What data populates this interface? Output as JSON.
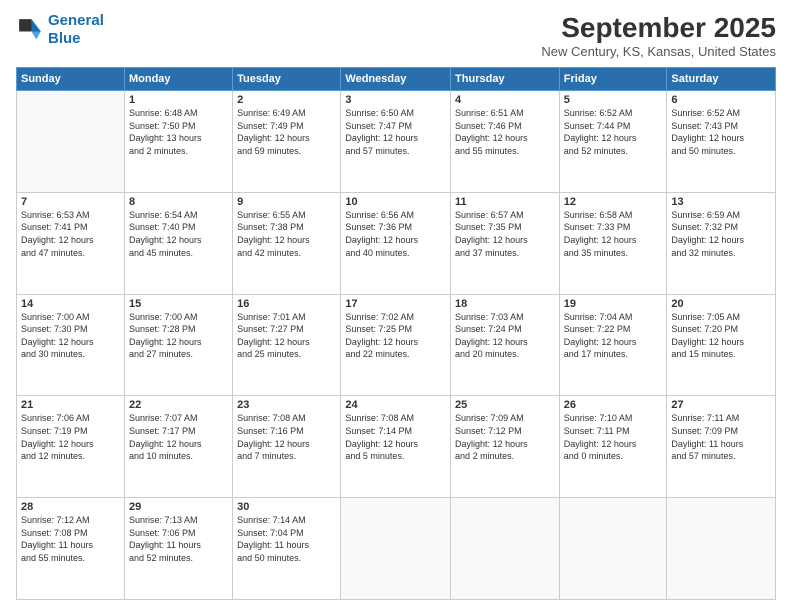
{
  "header": {
    "logo_line1": "General",
    "logo_line2": "Blue",
    "month": "September 2025",
    "location": "New Century, KS, Kansas, United States"
  },
  "weekdays": [
    "Sunday",
    "Monday",
    "Tuesday",
    "Wednesday",
    "Thursday",
    "Friday",
    "Saturday"
  ],
  "weeks": [
    [
      {
        "day": "",
        "info": ""
      },
      {
        "day": "1",
        "info": "Sunrise: 6:48 AM\nSunset: 7:50 PM\nDaylight: 13 hours\nand 2 minutes."
      },
      {
        "day": "2",
        "info": "Sunrise: 6:49 AM\nSunset: 7:49 PM\nDaylight: 12 hours\nand 59 minutes."
      },
      {
        "day": "3",
        "info": "Sunrise: 6:50 AM\nSunset: 7:47 PM\nDaylight: 12 hours\nand 57 minutes."
      },
      {
        "day": "4",
        "info": "Sunrise: 6:51 AM\nSunset: 7:46 PM\nDaylight: 12 hours\nand 55 minutes."
      },
      {
        "day": "5",
        "info": "Sunrise: 6:52 AM\nSunset: 7:44 PM\nDaylight: 12 hours\nand 52 minutes."
      },
      {
        "day": "6",
        "info": "Sunrise: 6:52 AM\nSunset: 7:43 PM\nDaylight: 12 hours\nand 50 minutes."
      }
    ],
    [
      {
        "day": "7",
        "info": "Sunrise: 6:53 AM\nSunset: 7:41 PM\nDaylight: 12 hours\nand 47 minutes."
      },
      {
        "day": "8",
        "info": "Sunrise: 6:54 AM\nSunset: 7:40 PM\nDaylight: 12 hours\nand 45 minutes."
      },
      {
        "day": "9",
        "info": "Sunrise: 6:55 AM\nSunset: 7:38 PM\nDaylight: 12 hours\nand 42 minutes."
      },
      {
        "day": "10",
        "info": "Sunrise: 6:56 AM\nSunset: 7:36 PM\nDaylight: 12 hours\nand 40 minutes."
      },
      {
        "day": "11",
        "info": "Sunrise: 6:57 AM\nSunset: 7:35 PM\nDaylight: 12 hours\nand 37 minutes."
      },
      {
        "day": "12",
        "info": "Sunrise: 6:58 AM\nSunset: 7:33 PM\nDaylight: 12 hours\nand 35 minutes."
      },
      {
        "day": "13",
        "info": "Sunrise: 6:59 AM\nSunset: 7:32 PM\nDaylight: 12 hours\nand 32 minutes."
      }
    ],
    [
      {
        "day": "14",
        "info": "Sunrise: 7:00 AM\nSunset: 7:30 PM\nDaylight: 12 hours\nand 30 minutes."
      },
      {
        "day": "15",
        "info": "Sunrise: 7:00 AM\nSunset: 7:28 PM\nDaylight: 12 hours\nand 27 minutes."
      },
      {
        "day": "16",
        "info": "Sunrise: 7:01 AM\nSunset: 7:27 PM\nDaylight: 12 hours\nand 25 minutes."
      },
      {
        "day": "17",
        "info": "Sunrise: 7:02 AM\nSunset: 7:25 PM\nDaylight: 12 hours\nand 22 minutes."
      },
      {
        "day": "18",
        "info": "Sunrise: 7:03 AM\nSunset: 7:24 PM\nDaylight: 12 hours\nand 20 minutes."
      },
      {
        "day": "19",
        "info": "Sunrise: 7:04 AM\nSunset: 7:22 PM\nDaylight: 12 hours\nand 17 minutes."
      },
      {
        "day": "20",
        "info": "Sunrise: 7:05 AM\nSunset: 7:20 PM\nDaylight: 12 hours\nand 15 minutes."
      }
    ],
    [
      {
        "day": "21",
        "info": "Sunrise: 7:06 AM\nSunset: 7:19 PM\nDaylight: 12 hours\nand 12 minutes."
      },
      {
        "day": "22",
        "info": "Sunrise: 7:07 AM\nSunset: 7:17 PM\nDaylight: 12 hours\nand 10 minutes."
      },
      {
        "day": "23",
        "info": "Sunrise: 7:08 AM\nSunset: 7:16 PM\nDaylight: 12 hours\nand 7 minutes."
      },
      {
        "day": "24",
        "info": "Sunrise: 7:08 AM\nSunset: 7:14 PM\nDaylight: 12 hours\nand 5 minutes."
      },
      {
        "day": "25",
        "info": "Sunrise: 7:09 AM\nSunset: 7:12 PM\nDaylight: 12 hours\nand 2 minutes."
      },
      {
        "day": "26",
        "info": "Sunrise: 7:10 AM\nSunset: 7:11 PM\nDaylight: 12 hours\nand 0 minutes."
      },
      {
        "day": "27",
        "info": "Sunrise: 7:11 AM\nSunset: 7:09 PM\nDaylight: 11 hours\nand 57 minutes."
      }
    ],
    [
      {
        "day": "28",
        "info": "Sunrise: 7:12 AM\nSunset: 7:08 PM\nDaylight: 11 hours\nand 55 minutes."
      },
      {
        "day": "29",
        "info": "Sunrise: 7:13 AM\nSunset: 7:06 PM\nDaylight: 11 hours\nand 52 minutes."
      },
      {
        "day": "30",
        "info": "Sunrise: 7:14 AM\nSunset: 7:04 PM\nDaylight: 11 hours\nand 50 minutes."
      },
      {
        "day": "",
        "info": ""
      },
      {
        "day": "",
        "info": ""
      },
      {
        "day": "",
        "info": ""
      },
      {
        "day": "",
        "info": ""
      }
    ]
  ]
}
